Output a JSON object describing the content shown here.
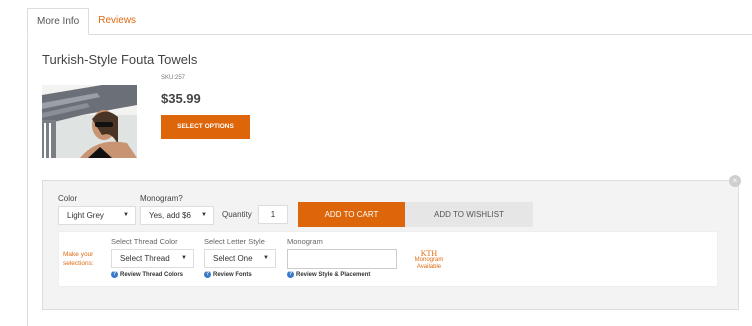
{
  "tabs": [
    {
      "label": "More Info",
      "active": true
    },
    {
      "label": "Reviews",
      "active": false
    }
  ],
  "product": {
    "title": "Turkish-Style Fouta Towels",
    "sku": "SKU:257",
    "price": "$35.99",
    "select_options_label": "SELECT OPTIONS"
  },
  "options": {
    "color_label": "Color",
    "color_value": "Light Grey",
    "monogram_label": "Monogram?",
    "monogram_value": "Yes, add $6",
    "quantity_label": "Quantity",
    "quantity_value": "1",
    "add_to_cart": "ADD TO CART",
    "add_to_wishlist": "ADD TO WISHLIST",
    "close_glyph": "×"
  },
  "monogram_panel": {
    "make_selections": "Make your selections:",
    "thread_label": "Select Thread Color",
    "thread_value": "Select Thread",
    "letter_label": "Select Letter Style",
    "letter_value": "Select One",
    "monogram_label": "Monogram",
    "review_thread": "Review Thread Colors",
    "review_fonts": "Review Fonts",
    "review_style": "Review Style & Placement",
    "kth_text": "KTH",
    "kth_caption_1": "Monogram",
    "kth_caption_2": "Available"
  },
  "colors": {
    "accent": "#dd650a",
    "link": "#e06b12",
    "help": "#3b7ac9"
  }
}
